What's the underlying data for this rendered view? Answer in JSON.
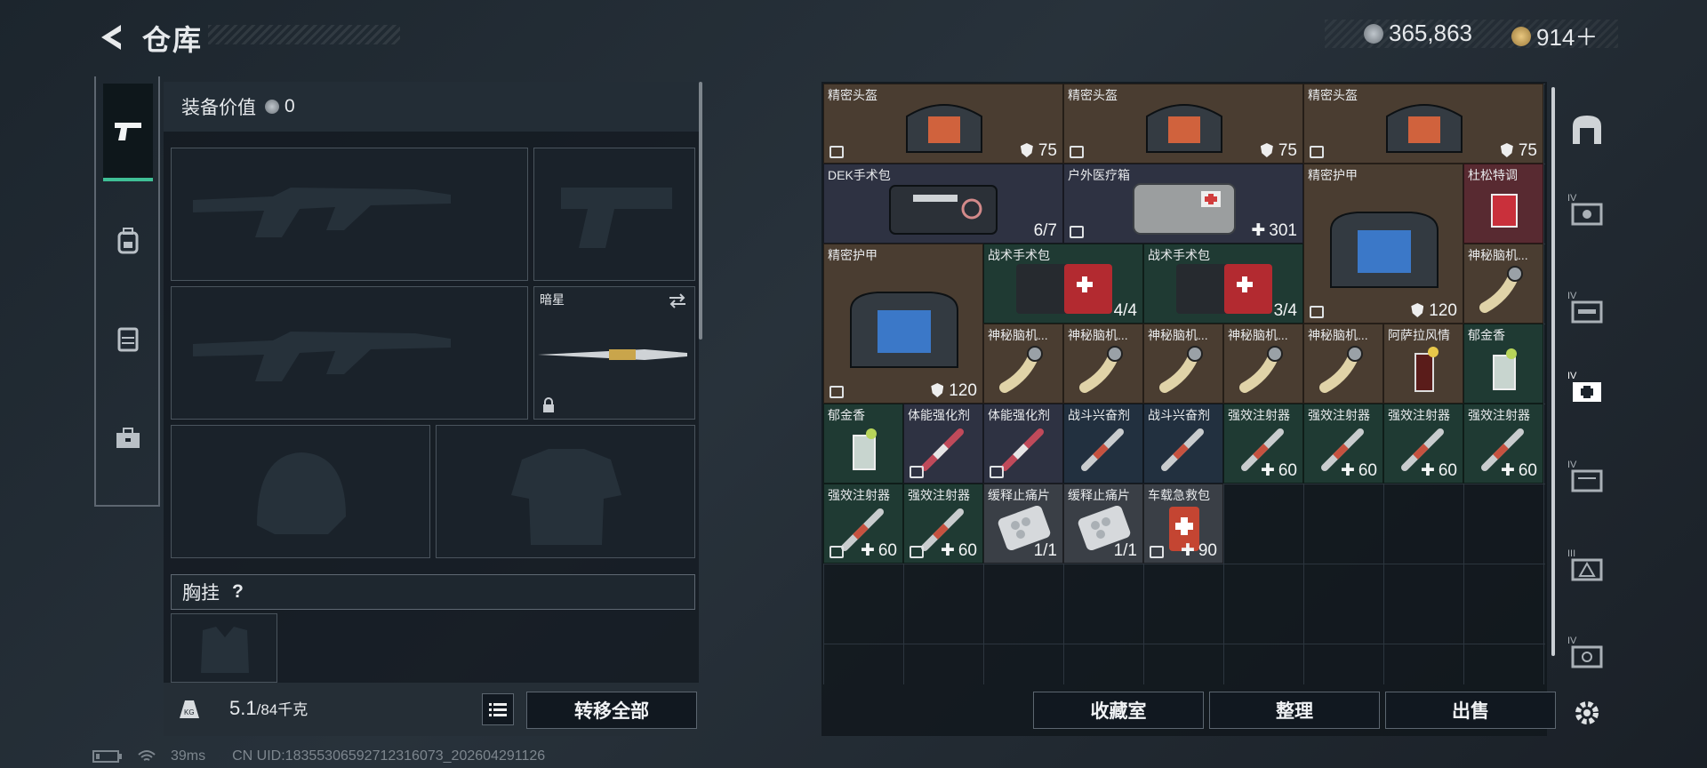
{
  "header": {
    "title": "仓库",
    "currency1": "365,863",
    "currency2": "914＋"
  },
  "left": {
    "value_label": "装备价值",
    "value": "0",
    "melee_name": "暗星",
    "chest_label": "胸挂",
    "chest_help": "?",
    "weight": "5.1",
    "weight_max": "/84千克",
    "transfer_all": "转移全部"
  },
  "items": [
    {
      "name": "精密头盔",
      "value": "75",
      "kind": "shield",
      "bg": "#4a3d31",
      "c": 0,
      "r": 0,
      "w": 3,
      "h": 1,
      "art": "helmet"
    },
    {
      "name": "精密头盔",
      "value": "75",
      "kind": "shield",
      "bg": "#4a3d31",
      "c": 3,
      "r": 0,
      "w": 3,
      "h": 1,
      "art": "helmet"
    },
    {
      "name": "精密头盔",
      "value": "75",
      "kind": "shield",
      "bg": "#4a3d31",
      "c": 6,
      "r": 0,
      "w": 3,
      "h": 1,
      "art": "helmet"
    },
    {
      "name": "DEK手术包",
      "value": "6/7",
      "kind": "count",
      "bg": "#2e3242",
      "c": 0,
      "r": 1,
      "w": 3,
      "h": 1,
      "art": "kit"
    },
    {
      "name": "户外医疗箱",
      "value": "301",
      "kind": "heal",
      "bg": "#2e3242",
      "c": 3,
      "r": 1,
      "w": 3,
      "h": 1,
      "art": "box"
    },
    {
      "name": "精密护甲",
      "value": "120",
      "kind": "shield",
      "bg": "#4a3d31",
      "c": 6,
      "r": 1,
      "w": 2,
      "h": 2,
      "art": "armor"
    },
    {
      "name": "杜松特调",
      "value": "",
      "kind": "none",
      "bg": "#582a31",
      "c": 8,
      "r": 1,
      "w": 1,
      "h": 1,
      "art": "drinkred"
    },
    {
      "name": "精密护甲",
      "value": "120",
      "kind": "shield",
      "bg": "#4a3d31",
      "c": 0,
      "r": 2,
      "w": 2,
      "h": 2,
      "art": "armor"
    },
    {
      "name": "战术手术包",
      "value": "4/4",
      "kind": "count",
      "bg": "#1f3a33",
      "c": 2,
      "r": 2,
      "w": 2,
      "h": 1,
      "art": "redkit"
    },
    {
      "name": "战术手术包",
      "value": "3/4",
      "kind": "count",
      "bg": "#1f3a33",
      "c": 4,
      "r": 2,
      "w": 2,
      "h": 1,
      "art": "redkit"
    },
    {
      "name": "神秘脑机...",
      "value": "",
      "kind": "none",
      "bg": "#4a3d31",
      "c": 8,
      "r": 2,
      "w": 1,
      "h": 1,
      "art": "brain"
    },
    {
      "name": "神秘脑机...",
      "value": "",
      "kind": "none",
      "bg": "#4a3d31",
      "c": 2,
      "r": 3,
      "w": 1,
      "h": 1,
      "art": "brain"
    },
    {
      "name": "神秘脑机...",
      "value": "",
      "kind": "none",
      "bg": "#4a3d31",
      "c": 3,
      "r": 3,
      "w": 1,
      "h": 1,
      "art": "brain"
    },
    {
      "name": "神秘脑机...",
      "value": "",
      "kind": "none",
      "bg": "#4a3d31",
      "c": 4,
      "r": 3,
      "w": 1,
      "h": 1,
      "art": "brain"
    },
    {
      "name": "神秘脑机...",
      "value": "",
      "kind": "none",
      "bg": "#4a3d31",
      "c": 5,
      "r": 3,
      "w": 1,
      "h": 1,
      "art": "brain"
    },
    {
      "name": "神秘脑机...",
      "value": "",
      "kind": "none",
      "bg": "#4a3d31",
      "c": 6,
      "r": 3,
      "w": 1,
      "h": 1,
      "art": "brain"
    },
    {
      "name": "阿萨拉风情",
      "value": "",
      "kind": "none",
      "bg": "#4a3d31",
      "c": 7,
      "r": 3,
      "w": 1,
      "h": 1,
      "art": "drinkdark"
    },
    {
      "name": "郁金香",
      "value": "",
      "kind": "none",
      "bg": "#1f3a33",
      "c": 8,
      "r": 3,
      "w": 1,
      "h": 1,
      "art": "drinkclear"
    },
    {
      "name": "郁金香",
      "value": "",
      "kind": "none",
      "bg": "#1f3a33",
      "c": 0,
      "r": 4,
      "w": 1,
      "h": 1,
      "art": "drinkclear"
    },
    {
      "name": "体能强化剂",
      "value": "",
      "kind": "ic",
      "bg": "#2e3242",
      "c": 1,
      "r": 4,
      "w": 1,
      "h": 1,
      "art": "syringered"
    },
    {
      "name": "体能强化剂",
      "value": "",
      "kind": "ic",
      "bg": "#2e3242",
      "c": 2,
      "r": 4,
      "w": 1,
      "h": 1,
      "art": "syringered"
    },
    {
      "name": "战斗兴奋剂",
      "value": "",
      "kind": "none",
      "bg": "#22303f",
      "c": 3,
      "r": 4,
      "w": 1,
      "h": 1,
      "art": "syringe"
    },
    {
      "name": "战斗兴奋剂",
      "value": "",
      "kind": "none",
      "bg": "#22303f",
      "c": 4,
      "r": 4,
      "w": 1,
      "h": 1,
      "art": "syringe"
    },
    {
      "name": "强效注射器",
      "value": "60",
      "kind": "heal",
      "bg": "#1f3a33",
      "c": 5,
      "r": 4,
      "w": 1,
      "h": 1,
      "art": "syringe"
    },
    {
      "name": "强效注射器",
      "value": "60",
      "kind": "heal",
      "bg": "#1f3a33",
      "c": 6,
      "r": 4,
      "w": 1,
      "h": 1,
      "art": "syringe"
    },
    {
      "name": "强效注射器",
      "value": "60",
      "kind": "heal",
      "bg": "#1f3a33",
      "c": 7,
      "r": 4,
      "w": 1,
      "h": 1,
      "art": "syringe"
    },
    {
      "name": "强效注射器",
      "value": "60",
      "kind": "heal",
      "bg": "#1f3a33",
      "c": 8,
      "r": 4,
      "w": 1,
      "h": 1,
      "art": "syringe"
    },
    {
      "name": "强效注射器",
      "value": "60",
      "kind": "heal",
      "bg": "#1f3a33",
      "c": 0,
      "r": 5,
      "w": 1,
      "h": 1,
      "art": "syringe"
    },
    {
      "name": "强效注射器",
      "value": "60",
      "kind": "healic",
      "bg": "#1f3a33",
      "c": 1,
      "r": 5,
      "w": 1,
      "h": 1,
      "art": "syringe"
    },
    {
      "name": "缓释止痛片",
      "value": "1/1",
      "kind": "count",
      "bg": "#3a3f46",
      "c": 2,
      "r": 5,
      "w": 1,
      "h": 1,
      "art": "pills"
    },
    {
      "name": "缓释止痛片",
      "value": "1/1",
      "kind": "count",
      "bg": "#3a3f46",
      "c": 3,
      "r": 5,
      "w": 1,
      "h": 1,
      "art": "pills"
    },
    {
      "name": "车载急救包",
      "value": "90",
      "kind": "healic",
      "bg": "#3a3f46",
      "c": 4,
      "r": 5,
      "w": 1,
      "h": 1,
      "art": "redbag"
    }
  ],
  "right": {
    "collection": "收藏室",
    "organize": "整理",
    "sell": "出售"
  },
  "status": {
    "ping": "39ms",
    "uid": "CN UID:18355306592712316073_202604291126"
  }
}
